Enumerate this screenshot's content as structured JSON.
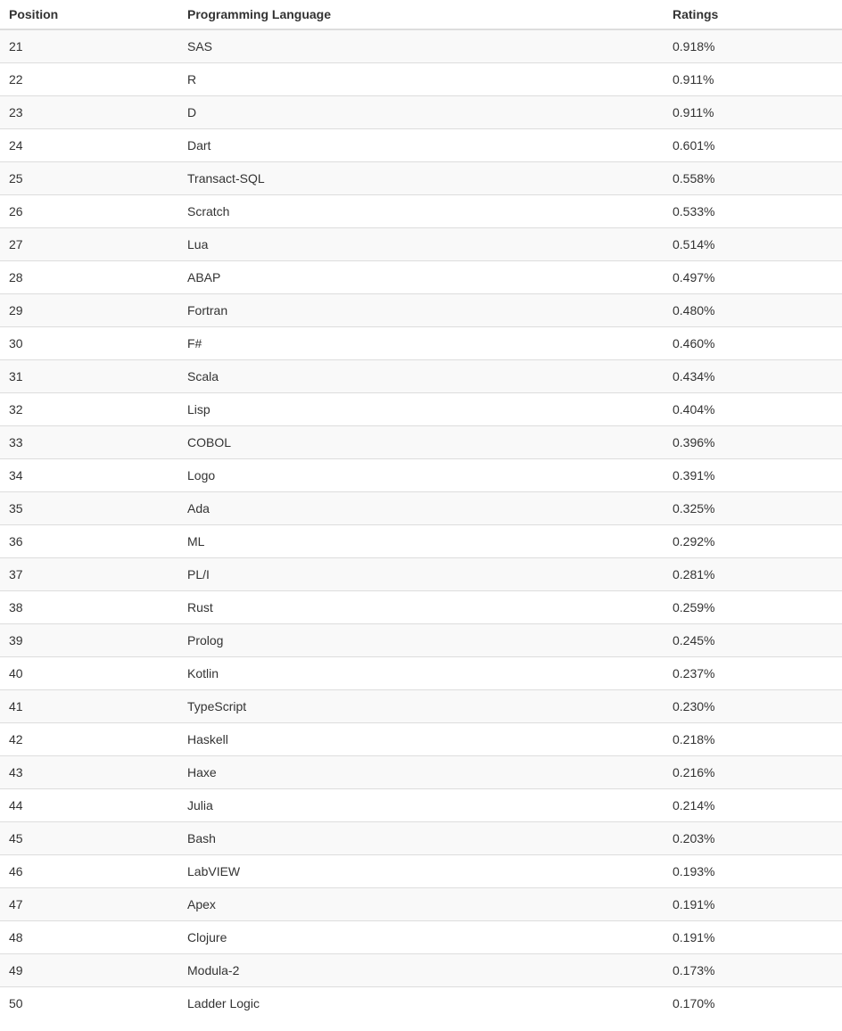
{
  "table": {
    "headers": {
      "position": "Position",
      "language": "Programming Language",
      "ratings": "Ratings"
    },
    "rows": [
      {
        "position": "21",
        "language": "SAS",
        "ratings": "0.918%"
      },
      {
        "position": "22",
        "language": "R",
        "ratings": "0.911%"
      },
      {
        "position": "23",
        "language": "D",
        "ratings": "0.911%"
      },
      {
        "position": "24",
        "language": "Dart",
        "ratings": "0.601%"
      },
      {
        "position": "25",
        "language": "Transact-SQL",
        "ratings": "0.558%"
      },
      {
        "position": "26",
        "language": "Scratch",
        "ratings": "0.533%"
      },
      {
        "position": "27",
        "language": "Lua",
        "ratings": "0.514%"
      },
      {
        "position": "28",
        "language": "ABAP",
        "ratings": "0.497%"
      },
      {
        "position": "29",
        "language": "Fortran",
        "ratings": "0.480%"
      },
      {
        "position": "30",
        "language": "F#",
        "ratings": "0.460%"
      },
      {
        "position": "31",
        "language": "Scala",
        "ratings": "0.434%"
      },
      {
        "position": "32",
        "language": "Lisp",
        "ratings": "0.404%"
      },
      {
        "position": "33",
        "language": "COBOL",
        "ratings": "0.396%"
      },
      {
        "position": "34",
        "language": "Logo",
        "ratings": "0.391%"
      },
      {
        "position": "35",
        "language": "Ada",
        "ratings": "0.325%"
      },
      {
        "position": "36",
        "language": "ML",
        "ratings": "0.292%"
      },
      {
        "position": "37",
        "language": "PL/I",
        "ratings": "0.281%"
      },
      {
        "position": "38",
        "language": "Rust",
        "ratings": "0.259%"
      },
      {
        "position": "39",
        "language": "Prolog",
        "ratings": "0.245%"
      },
      {
        "position": "40",
        "language": "Kotlin",
        "ratings": "0.237%"
      },
      {
        "position": "41",
        "language": "TypeScript",
        "ratings": "0.230%"
      },
      {
        "position": "42",
        "language": "Haskell",
        "ratings": "0.218%"
      },
      {
        "position": "43",
        "language": "Haxe",
        "ratings": "0.216%"
      },
      {
        "position": "44",
        "language": "Julia",
        "ratings": "0.214%"
      },
      {
        "position": "45",
        "language": "Bash",
        "ratings": "0.203%"
      },
      {
        "position": "46",
        "language": "LabVIEW",
        "ratings": "0.193%"
      },
      {
        "position": "47",
        "language": "Apex",
        "ratings": "0.191%"
      },
      {
        "position": "48",
        "language": "Clojure",
        "ratings": "0.191%"
      },
      {
        "position": "49",
        "language": "Modula-2",
        "ratings": "0.173%"
      },
      {
        "position": "50",
        "language": "Ladder Logic",
        "ratings": "0.170%"
      }
    ]
  }
}
